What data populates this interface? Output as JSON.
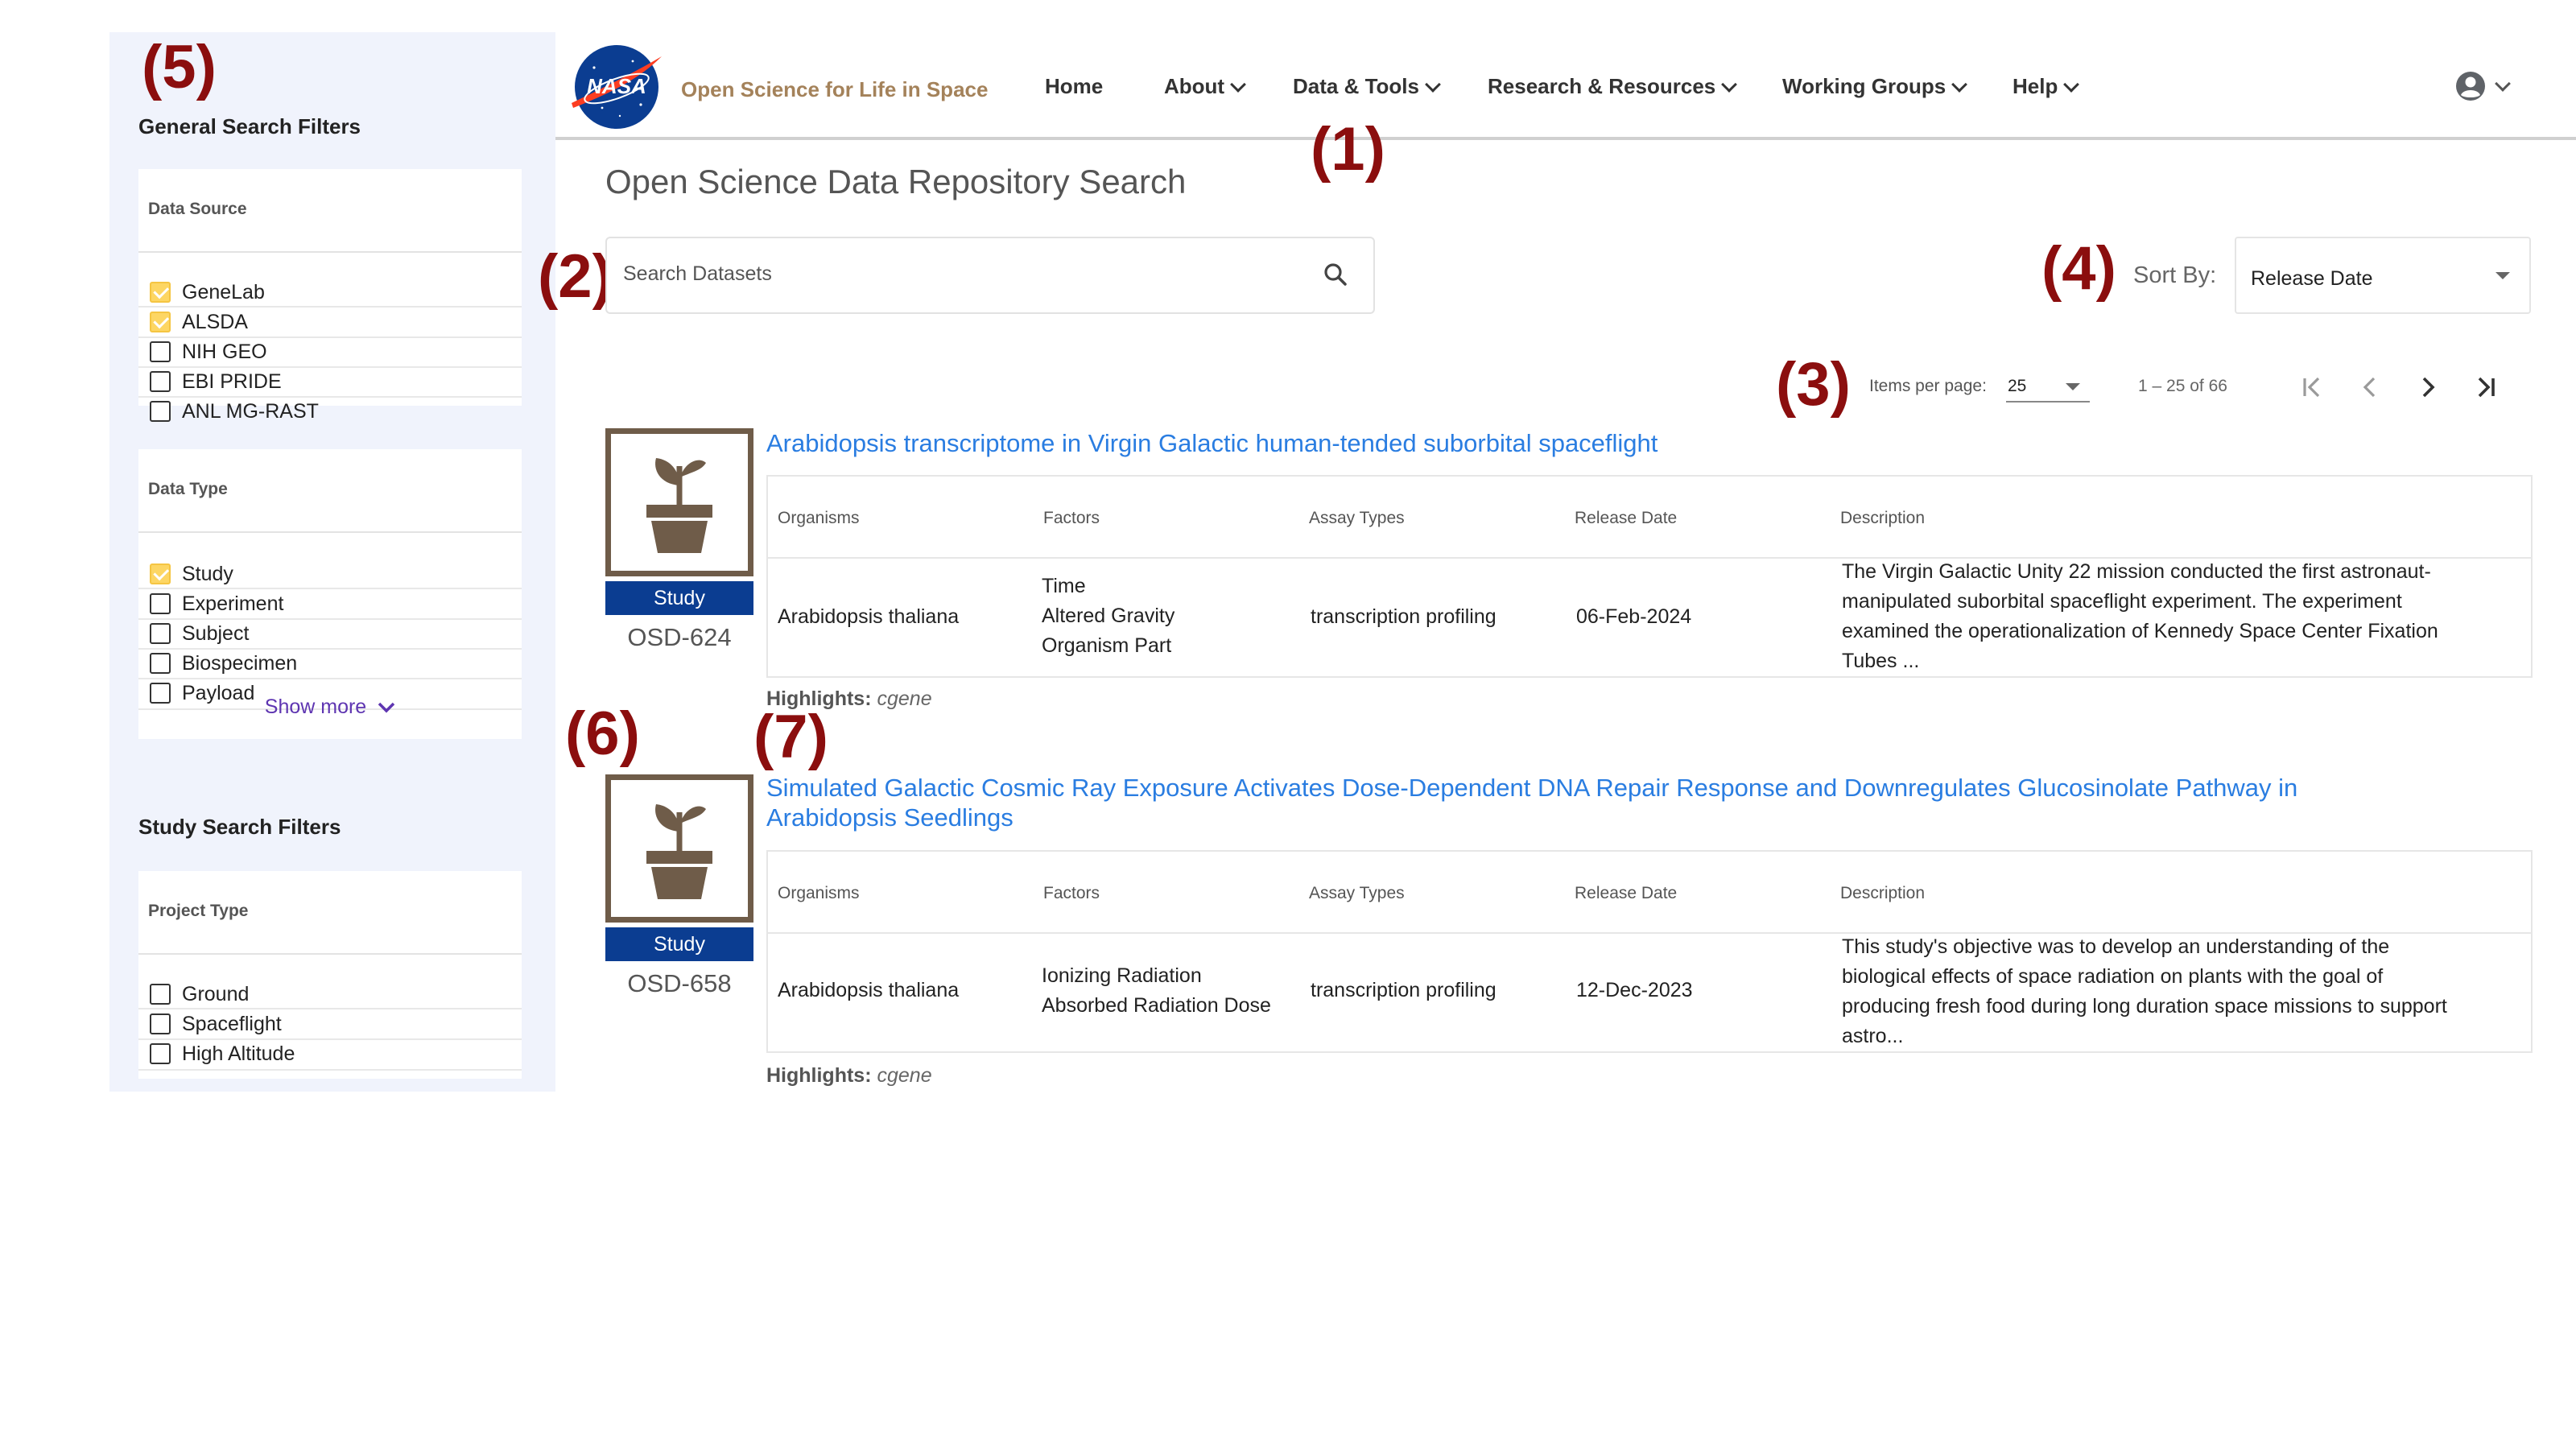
{
  "annotations": {
    "a1": "(1)",
    "a2": "(2)",
    "a3": "(3)",
    "a4": "(4)",
    "a5": "(5)",
    "a6": "(6)",
    "a7": "(7)"
  },
  "header": {
    "logo_text": "NASA",
    "brand": "Open Science for Life in Space",
    "nav": [
      "Home",
      "About",
      "Data & Tools",
      "Research & Resources",
      "Working Groups",
      "Help"
    ],
    "user_icon": "account-circle-icon"
  },
  "sidebar": {
    "general_heading": "General Search Filters",
    "data_source": {
      "title": "Data Source",
      "options": [
        {
          "label": "GeneLab",
          "checked": true
        },
        {
          "label": "ALSDA",
          "checked": true
        },
        {
          "label": "NIH GEO",
          "checked": false
        },
        {
          "label": "EBI PRIDE",
          "checked": false
        },
        {
          "label": "ANL MG-RAST",
          "checked": false
        }
      ]
    },
    "data_type": {
      "title": "Data Type",
      "options": [
        {
          "label": "Study",
          "checked": true
        },
        {
          "label": "Experiment",
          "checked": false
        },
        {
          "label": "Subject",
          "checked": false
        },
        {
          "label": "Biospecimen",
          "checked": false
        },
        {
          "label": "Payload",
          "checked": false
        }
      ],
      "show_more": "Show more"
    },
    "study_heading": "Study Search Filters",
    "project_type": {
      "title": "Project Type",
      "options": [
        {
          "label": "Ground",
          "checked": false
        },
        {
          "label": "Spaceflight",
          "checked": false
        },
        {
          "label": "High Altitude",
          "checked": false
        }
      ]
    }
  },
  "main": {
    "title": "Open Science Data Repository Search",
    "search_placeholder": "Search Datasets",
    "sort_label": "Sort By:",
    "sort_value": "Release Date",
    "paginator": {
      "items_per_page_label": "Items per page:",
      "items_per_page": "25",
      "range": "1 – 25 of 66"
    },
    "columns": [
      "Organisms",
      "Factors",
      "Assay Types",
      "Release Date",
      "Description"
    ],
    "results": [
      {
        "id": "OSD-624",
        "badge": "Study",
        "title": "Arabidopsis transcriptome in Virgin Galactic human-tended suborbital spaceflight",
        "organism": "Arabidopsis thaliana",
        "factors": [
          "Time",
          "Altered Gravity",
          "Organism Part"
        ],
        "assay": "transcription profiling",
        "release_date": "06-Feb-2024",
        "description": [
          "The Virgin Galactic Unity 22 mission conducted the first astronaut-",
          "manipulated suborbital spaceflight experiment. The experiment",
          "examined the operationalization of Kennedy Space Center Fixation",
          "Tubes ..."
        ],
        "highlights_label": "Highlights:",
        "highlights": "cgene"
      },
      {
        "id": "OSD-658",
        "badge": "Study",
        "title": [
          "Simulated Galactic Cosmic Ray Exposure Activates Dose-Dependent DNA Repair Response and Downregulates Glucosinolate Pathway in",
          "Arabidopsis Seedlings"
        ],
        "organism": "Arabidopsis thaliana",
        "factors": [
          "Ionizing Radiation",
          "Absorbed Radiation Dose"
        ],
        "assay": "transcription profiling",
        "release_date": "12-Dec-2023",
        "description": [
          "This study's objective was to develop an understanding of the",
          "biological effects of space radiation on plants with the goal of",
          "producing fresh food during long duration space missions to support",
          "astro..."
        ],
        "highlights_label": "Highlights:",
        "highlights": "cgene"
      }
    ]
  },
  "colors": {
    "sidebar_bg": "#f0f3fc",
    "link": "#2a7de1",
    "badge": "#0b3d91",
    "brand": "#a4825a",
    "annotation": "#8b0e0e",
    "checkbox_checked": "#fdd663",
    "thumb_border": "#6f5c49"
  }
}
